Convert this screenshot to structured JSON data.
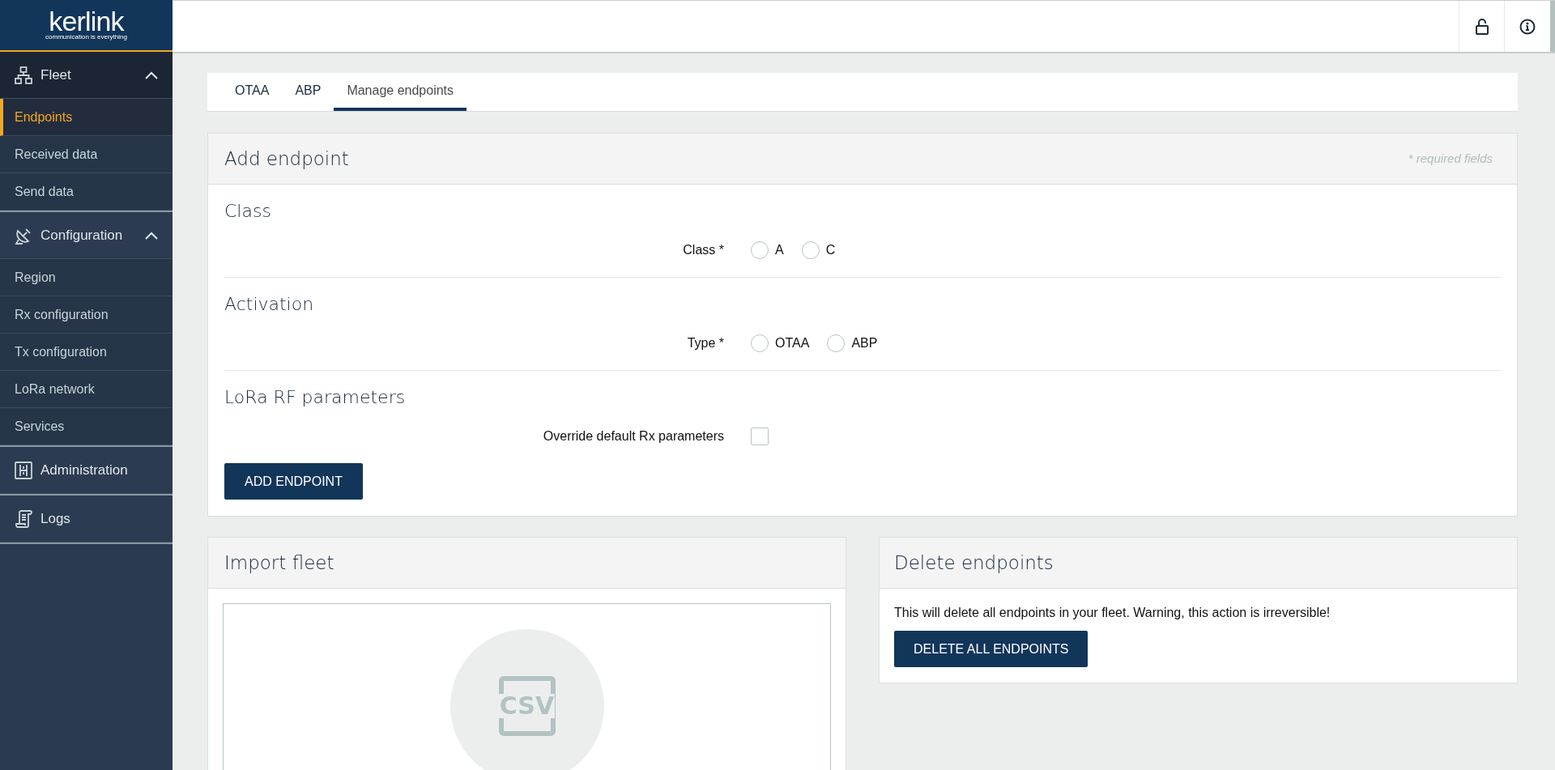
{
  "logo": {
    "wordmark": "kerlink",
    "tagline": "communication is everything"
  },
  "sidebar": [
    {
      "label": "Fleet",
      "expanded": true,
      "items": [
        {
          "label": "Endpoints",
          "selected": true
        },
        {
          "label": "Received data",
          "selected": false
        },
        {
          "label": "Send data",
          "selected": false
        }
      ]
    },
    {
      "label": "Configuration",
      "expanded": true,
      "items": [
        {
          "label": "Region",
          "selected": false
        },
        {
          "label": "Rx configuration",
          "selected": false
        },
        {
          "label": "Tx configuration",
          "selected": false
        },
        {
          "label": "LoRa network",
          "selected": false
        },
        {
          "label": "Services",
          "selected": false
        }
      ]
    },
    {
      "label": "Administration"
    },
    {
      "label": "Logs"
    }
  ],
  "tabs": [
    {
      "label": "OTAA",
      "selected": false
    },
    {
      "label": "ABP",
      "selected": false
    },
    {
      "label": "Manage endpoints",
      "selected": true
    }
  ],
  "add_endpoint": {
    "title": "Add endpoint",
    "note": "* required fields",
    "sections": [
      {
        "title": "Class",
        "field": {
          "kind": "radio",
          "label": "Class *",
          "options": [
            {
              "label": "A",
              "selected": false
            },
            {
              "label": "C",
              "selected": false
            }
          ]
        }
      },
      {
        "title": "Activation",
        "field": {
          "kind": "radio",
          "label": "Type *",
          "options": [
            {
              "label": "OTAA",
              "selected": false
            },
            {
              "label": "ABP",
              "selected": false
            }
          ]
        }
      },
      {
        "title": "LoRa RF parameters",
        "field": {
          "kind": "checkbox",
          "label": "Override default Rx parameters",
          "checked": false
        }
      }
    ],
    "button": "ADD ENDPOINT"
  },
  "import_fleet": {
    "title": "Import fleet",
    "icon_label": "CSV"
  },
  "delete_endpoints": {
    "title": "Delete endpoints",
    "message": "This will delete all endpoints in your fleet. Warning, this action is irreversible!",
    "button": "DELETE ALL ENDPOINTS"
  }
}
